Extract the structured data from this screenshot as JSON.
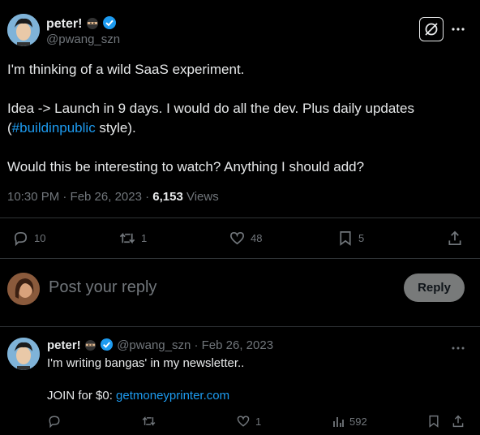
{
  "main_tweet": {
    "display_name": "peter!",
    "handle": "@pwang_szn",
    "line1": "I'm thinking of a wild SaaS experiment.",
    "line2": "Idea -> Launch in 9 days. I would do all the dev. Plus daily updates",
    "line3_prefix": "(",
    "hashtag": "#buildinpublic",
    "line3_suffix": " style).",
    "line4": "Would this be interesting to watch? Anything I should add?",
    "timestamp": "10:30 PM · Feb 26, 2023 · ",
    "views_count": "6,153",
    "views_label": " Views",
    "replies": "10",
    "reposts": "1",
    "likes": "48",
    "bookmarks": "5"
  },
  "composer": {
    "placeholder": "Post your reply",
    "reply_button": "Reply"
  },
  "reply_tweet": {
    "display_name": "peter!",
    "handle_date": "@pwang_szn · Feb 26, 2023",
    "line1": "I'm writing bangas' in my newsletter..",
    "line2_prefix": "JOIN for $0: ",
    "link": "getmoneyprinter.com",
    "replies": "",
    "reposts": "",
    "likes": "1",
    "views": "592"
  },
  "icons": [
    "verified-badge-icon",
    "ninja-emoji-icon",
    "grok-icon",
    "more-icon",
    "reply-icon",
    "repost-icon",
    "like-icon",
    "bookmark-icon",
    "share-icon",
    "views-icon"
  ],
  "colors": {
    "accent": "#1d9bf0",
    "background": "#000000",
    "text": "#e7e9ea",
    "muted": "#71767b",
    "divider": "#2f3336"
  }
}
